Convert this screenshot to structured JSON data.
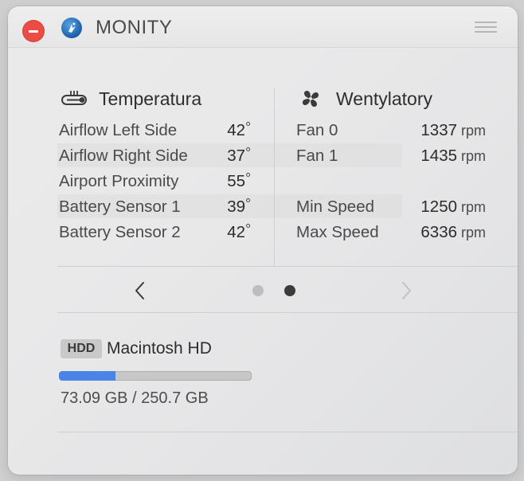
{
  "app": {
    "title": "MONITY"
  },
  "temperature": {
    "heading": "Temperatura",
    "icon": "thermometer-icon",
    "items": [
      {
        "label": "Airflow Left Side",
        "value": "42",
        "unit": "°"
      },
      {
        "label": "Airflow Right Side",
        "value": "37",
        "unit": "°"
      },
      {
        "label": "Airport Proximity",
        "value": "55",
        "unit": "°"
      },
      {
        "label": "Battery Sensor 1",
        "value": "39",
        "unit": "°"
      },
      {
        "label": "Battery Sensor 2",
        "value": "42",
        "unit": "°"
      }
    ]
  },
  "fans": {
    "heading": "Wentylatory",
    "icon": "fan-icon",
    "items": [
      {
        "label": "Fan 0",
        "value": "1337",
        "unit": "rpm"
      },
      {
        "label": "Fan 1",
        "value": "1435",
        "unit": "rpm"
      }
    ],
    "speeds": [
      {
        "label": "Min Speed",
        "value": "1250",
        "unit": "rpm"
      },
      {
        "label": "Max Speed",
        "value": "6336",
        "unit": "rpm"
      }
    ]
  },
  "pager": {
    "pages": 2,
    "current_page": 2
  },
  "disk": {
    "badge": "HDD",
    "name": "Macintosh HD",
    "usage_text": "73.09 GB / 250.7 GB",
    "used_fraction": 0.2915
  },
  "colors": {
    "close": "#ec4b43",
    "progress": "#4a84e6",
    "dot_active": "#3b3b3b",
    "dot_inactive": "#bdbdbd"
  }
}
